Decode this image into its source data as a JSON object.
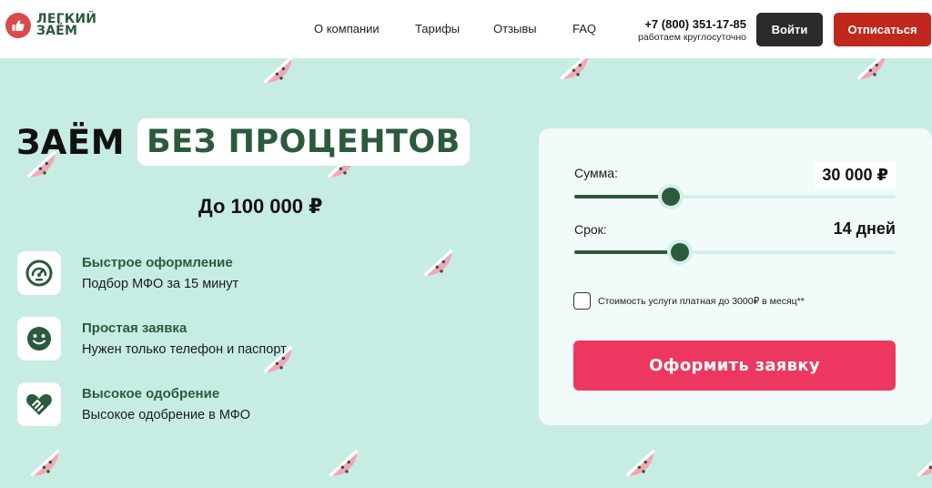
{
  "brand": {
    "line1": "ЛЕГКИЙ",
    "line2": "ЗАЁМ",
    "logo_icon": "thumbs-up-icon",
    "logo_color": "#d94a4a",
    "brand_color": "#2b5a3c"
  },
  "nav": {
    "items": [
      {
        "label": "О компании"
      },
      {
        "label": "Тарифы"
      },
      {
        "label": "Отзывы"
      },
      {
        "label": "FAQ"
      }
    ]
  },
  "contact": {
    "phone": "+7 (800) 351-17-85",
    "hours": "работаем круглосуточно"
  },
  "header_buttons": {
    "login": "Войти",
    "unsubscribe": "Отписаться"
  },
  "hero": {
    "title_part1": "ЗАЁМ",
    "title_part2": "БЕЗ ПРОЦЕНТОВ",
    "subtitle": "До 100 000 ₽"
  },
  "features": [
    {
      "title": "Быстрое оформление",
      "text": "Подбор МФО за 15 минут",
      "icon": "speedometer-icon"
    },
    {
      "title": "Простая заявка",
      "text": "Нужен только телефон и паспорт",
      "icon": "smile-icon"
    },
    {
      "title": "Высокое одобрение",
      "text": "Высокое одобрение в МФО",
      "icon": "handshake-heart-icon"
    }
  ],
  "calculator": {
    "amount": {
      "label": "Сумма:",
      "value": "30 000 ₽",
      "level_fraction": 0.3
    },
    "term": {
      "label": "Срок:",
      "value": "14 дней",
      "level_fraction": 0.33
    },
    "checkbox_label": "Стоимость услуги платная до 3000₽ в месяц**",
    "checkbox_checked": false,
    "submit_label": "Оформить заявку"
  },
  "colors": {
    "background": "#c7ece4",
    "accent_green": "#2b5a3c",
    "submit_pink": "#ec3860",
    "unsubscribe_red": "#c0281d",
    "login_dark": "#2b2b2b"
  }
}
